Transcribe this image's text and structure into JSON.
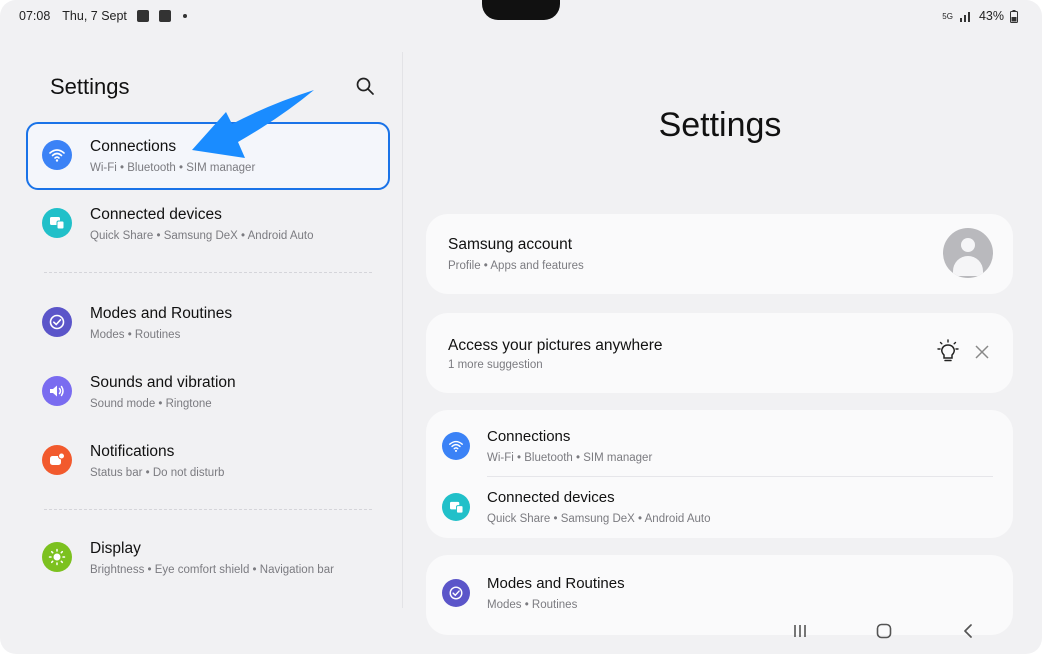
{
  "status_bar": {
    "time": "07:08",
    "date": "Thu, 7 Sept",
    "network": "5G",
    "battery": "43%"
  },
  "left": {
    "title": "Settings",
    "items": [
      {
        "title": "Connections",
        "subtitle": "Wi-Fi  •  Bluetooth  •  SIM manager",
        "color": "#3b82f6",
        "icon": "wifi-icon"
      },
      {
        "title": "Connected devices",
        "subtitle": "Quick Share  •  Samsung DeX  •  Android Auto",
        "color": "#21c0c9",
        "icon": "devices-icon"
      },
      {
        "title": "Modes and Routines",
        "subtitle": "Modes  •  Routines",
        "color": "#5b55c9",
        "icon": "check-circle-icon"
      },
      {
        "title": "Sounds and vibration",
        "subtitle": "Sound mode  •  Ringtone",
        "color": "#7a6cf0",
        "icon": "speaker-icon"
      },
      {
        "title": "Notifications",
        "subtitle": "Status bar  •  Do not disturb",
        "color": "#f25a2d",
        "icon": "bell-badge-icon"
      },
      {
        "title": "Display",
        "subtitle": "Brightness  •  Eye comfort shield  •  Navigation bar",
        "color": "#7cc11f",
        "icon": "sun-icon"
      }
    ]
  },
  "right": {
    "title": "Settings",
    "account": {
      "title": "Samsung account",
      "subtitle": "Profile  •  Apps and features"
    },
    "suggestion": {
      "title": "Access your pictures anywhere",
      "subtitle": "1 more suggestion"
    },
    "group1": [
      {
        "title": "Connections",
        "subtitle": "Wi-Fi  •  Bluetooth  •  SIM manager"
      },
      {
        "title": "Connected devices",
        "subtitle": "Quick Share  •  Samsung DeX  •  Android Auto"
      }
    ],
    "group2": [
      {
        "title": "Modes and Routines",
        "subtitle": "Modes  •  Routines"
      }
    ]
  },
  "colors": {
    "selection": "#1a73e8",
    "annotation_arrow": "#1a8cff"
  }
}
